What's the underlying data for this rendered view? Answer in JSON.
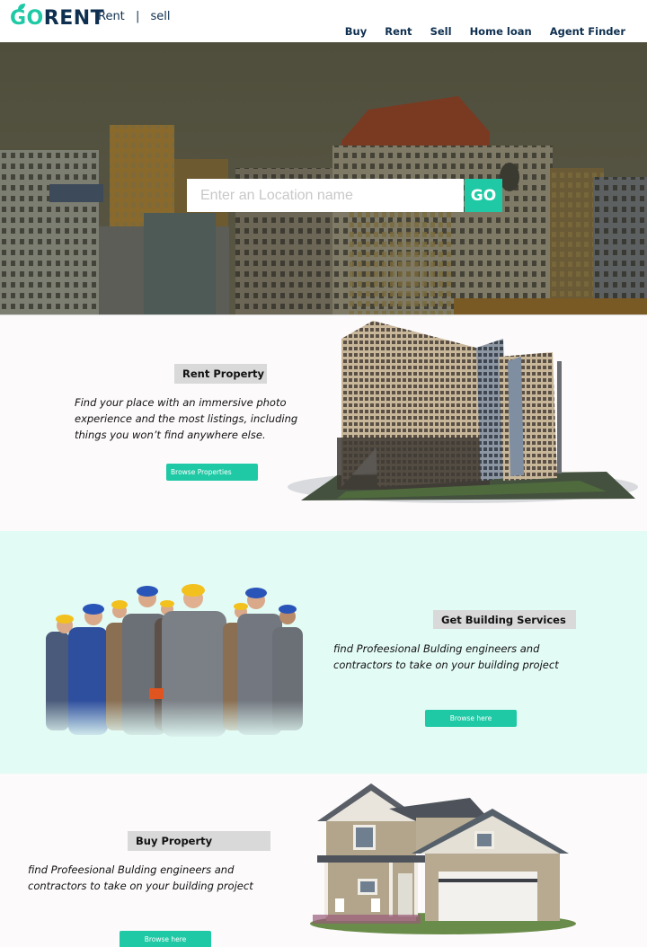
{
  "logo": {
    "go": "GO",
    "rent": "RENT"
  },
  "brand_nav": {
    "rent": "Rent",
    "separator": "|",
    "sell": "sell"
  },
  "main_nav": [
    "Buy",
    "Rent",
    "Sell",
    "Home loan",
    "Agent Finder"
  ],
  "search": {
    "placeholder": "Enter an Location name",
    "value": "",
    "button": "GO"
  },
  "rent_section": {
    "title": "Rent Property",
    "description": "Find your place with an immersive photo experience and the most listings, including things you won’t find anywhere else.",
    "cta": "Browse Properties"
  },
  "services_section": {
    "title": "Get  Building Services",
    "description": "find Profeesional Bulding engineers and contractors to take on your building project",
    "cta": "Browse here"
  },
  "buy_section": {
    "title": "Buy  Property",
    "description": "find Profeesional Bulding engineers and contractors to take on your building project",
    "cta": "Browse here"
  },
  "colors": {
    "accent": "#1fc9a5",
    "navy": "#0e2f4f",
    "mint_bg": "#e3fbf5",
    "pill_bg": "#d9d9d9"
  }
}
